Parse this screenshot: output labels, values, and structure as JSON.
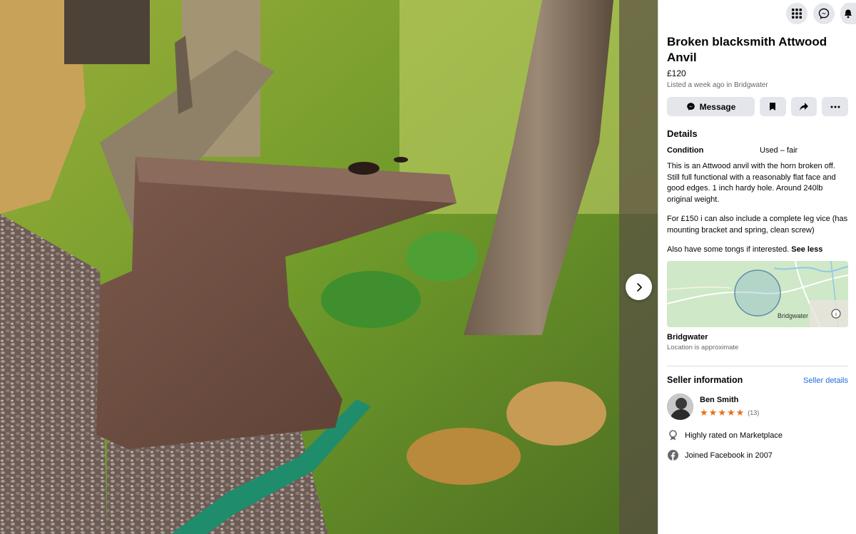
{
  "listing": {
    "title": "Broken blacksmith Attwood Anvil",
    "price": "£120",
    "listed": "Listed a week ago in Bridgwater"
  },
  "actions": {
    "message_label": "Message"
  },
  "details": {
    "heading": "Details",
    "condition_label": "Condition",
    "condition_value": "Used – fair",
    "paragraph1": "This is an Attwood anvil with the horn broken off. Still full functional with a reasonably flat face and good edges. 1 inch hardy hole. Around 240lb original weight.",
    "paragraph2": "For £150 i can also include a complete leg vice (has mounting bracket and spring, clean screw)",
    "paragraph3": "Also have some tongs if interested.",
    "see_less": "See less"
  },
  "location": {
    "map_label": "Bridgwater",
    "name": "Bridgwater",
    "note": "Location is approximate"
  },
  "seller": {
    "heading": "Seller information",
    "details_link": "Seller details",
    "name": "Ben Smith",
    "rating_count": "(13)",
    "stars": 5,
    "fact1": "Highly rated on Marketplace",
    "fact2": "Joined Facebook in 2007"
  },
  "icons": {
    "top": [
      "apps-grid-icon",
      "messenger-icon",
      "notifications-bell-icon"
    ],
    "actions": [
      "messenger-icon",
      "bookmark-icon",
      "share-icon",
      "more-icon"
    ],
    "next": "chevron-right-icon"
  },
  "colors": {
    "accent_link": "#216fdb",
    "star": "#e4711a",
    "button_bg": "#e4e6eb"
  }
}
